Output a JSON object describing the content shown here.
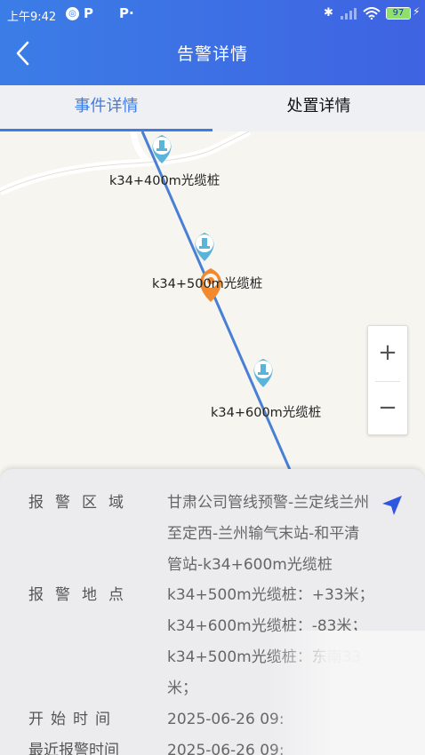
{
  "status_bar": {
    "time": "上午9:42",
    "battery": "97"
  },
  "header": {
    "title": "告警详情"
  },
  "tabs": [
    {
      "label": "事件详情",
      "active": true
    },
    {
      "label": "处置详情",
      "active": false
    }
  ],
  "map": {
    "markers": [
      {
        "label": "k34+400m光缆桩"
      },
      {
        "label": "k34+500m光缆桩"
      },
      {
        "label": "k34+600m光缆桩"
      }
    ],
    "zoom_in": "+",
    "zoom_out": "−",
    "colors": {
      "route": "#4a7fd6",
      "marker": "#5ab3d8",
      "alarm": "#f08a2c"
    }
  },
  "details": {
    "alarm_area_label": "报警区域",
    "alarm_area_lines": [
      "甘肃公司管线预警-兰定线兰州",
      "至定西-兰州输气末站-和平清",
      "管站-k34+600m光缆桩"
    ],
    "alarm_location_label": "报警地点",
    "alarm_location_lines": [
      "k34+500m光缆桩：+33米；",
      "k34+600m光缆桩：-83米；",
      "k34+500m光缆桩：东南33",
      "米；"
    ],
    "start_time_label": "开始时间",
    "start_time": "2025-06-26 09:",
    "recent_alarm_label": "最近报警时间",
    "recent_alarm_time": "2025-06-26 09:"
  }
}
